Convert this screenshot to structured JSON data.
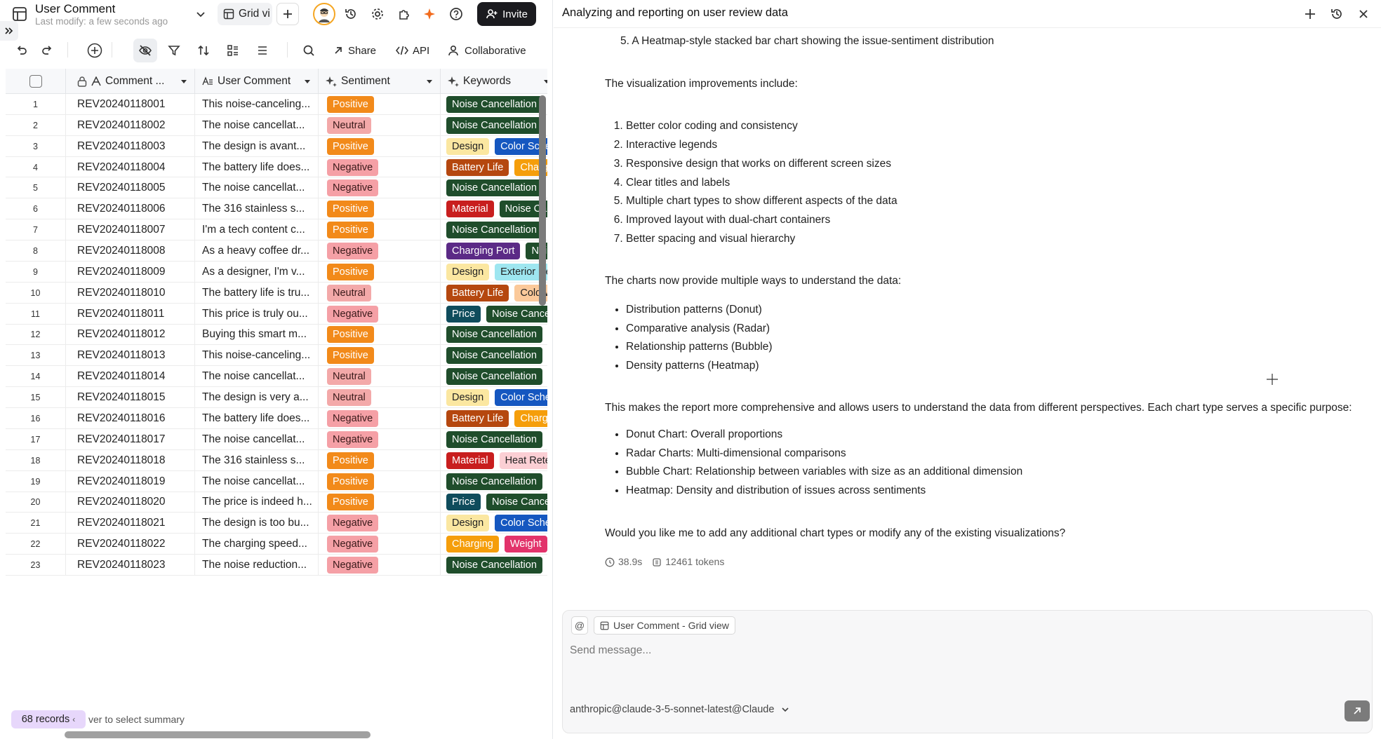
{
  "app": {
    "title": "User Comment",
    "subtitle": "Last modify: a few seconds ago",
    "view_tab": "Grid vi",
    "invite_label": "Invite"
  },
  "toolbar": {
    "share": "Share",
    "api": "API",
    "collaborative": "Collaborative"
  },
  "columns": [
    "Comment ...",
    "User Comment",
    "Sentiment",
    "Keywords"
  ],
  "rows": [
    {
      "no": "1",
      "id": "REV20240118001",
      "text": "This noise-canceling...",
      "sent": "Positive",
      "kw": [
        {
          "t": "Noise Cancellation",
          "c": "#1f4d2b"
        }
      ]
    },
    {
      "no": "2",
      "id": "REV20240118002",
      "text": "The noise cancellat...",
      "sent": "Neutral",
      "kw": [
        {
          "t": "Noise Cancellation",
          "c": "#1f4d2b"
        }
      ]
    },
    {
      "no": "3",
      "id": "REV20240118003",
      "text": "The design is avant...",
      "sent": "Positive",
      "kw": [
        {
          "t": "Design",
          "c": "#fbe7a1"
        },
        {
          "t": "Color Sche",
          "c": "#1557c0"
        }
      ]
    },
    {
      "no": "4",
      "id": "REV20240118004",
      "text": "The battery life does...",
      "sent": "Negative",
      "kw": [
        {
          "t": "Battery Life",
          "c": "#b5470f"
        },
        {
          "t": "Charg",
          "c": "#f59e0b"
        }
      ]
    },
    {
      "no": "5",
      "id": "REV20240118005",
      "text": "The noise cancellat...",
      "sent": "Negative",
      "kw": [
        {
          "t": "Noise Cancellation",
          "c": "#1f4d2b"
        }
      ]
    },
    {
      "no": "6",
      "id": "REV20240118006",
      "text": "The 316 stainless s...",
      "sent": "Positive",
      "kw": [
        {
          "t": "Material",
          "c": "#c81e1e"
        },
        {
          "t": "Noise Ca",
          "c": "#1f4d2b"
        }
      ]
    },
    {
      "no": "7",
      "id": "REV20240118007",
      "text": "I'm a tech content c...",
      "sent": "Positive",
      "kw": [
        {
          "t": "Noise Cancellation",
          "c": "#1f4d2b"
        }
      ]
    },
    {
      "no": "8",
      "id": "REV20240118008",
      "text": "As a heavy coffee dr...",
      "sent": "Negative",
      "kw": [
        {
          "t": "Charging Port",
          "c": "#5b2a86"
        },
        {
          "t": "Noi",
          "c": "#1f4d2b"
        }
      ]
    },
    {
      "no": "9",
      "id": "REV20240118009",
      "text": "As a designer, I'm v...",
      "sent": "Positive",
      "kw": [
        {
          "t": "Design",
          "c": "#fbe7a1"
        },
        {
          "t": "Exterior De",
          "c": "#9ee6f0"
        }
      ]
    },
    {
      "no": "10",
      "id": "REV20240118010",
      "text": "The battery life is tru...",
      "sent": "Neutral",
      "kw": [
        {
          "t": "Battery Life",
          "c": "#b5470f"
        },
        {
          "t": "Cold W",
          "c": "#fbc99a"
        }
      ]
    },
    {
      "no": "11",
      "id": "REV20240118011",
      "text": "This price is truly ou...",
      "sent": "Negative",
      "kw": [
        {
          "t": "Price",
          "c": "#0f4c5c"
        },
        {
          "t": "Noise Cance",
          "c": "#1f4d2b"
        }
      ]
    },
    {
      "no": "12",
      "id": "REV20240118012",
      "text": "Buying this smart m...",
      "sent": "Positive",
      "kw": [
        {
          "t": "Noise Cancellation",
          "c": "#1f4d2b"
        }
      ]
    },
    {
      "no": "13",
      "id": "REV20240118013",
      "text": "This noise-canceling...",
      "sent": "Positive",
      "kw": [
        {
          "t": "Noise Cancellation",
          "c": "#1f4d2b"
        }
      ]
    },
    {
      "no": "14",
      "id": "REV20240118014",
      "text": "The noise cancellat...",
      "sent": "Neutral",
      "kw": [
        {
          "t": "Noise Cancellation",
          "c": "#1f4d2b"
        }
      ]
    },
    {
      "no": "15",
      "id": "REV20240118015",
      "text": "The design is very a...",
      "sent": "Neutral",
      "kw": [
        {
          "t": "Design",
          "c": "#fbe7a1"
        },
        {
          "t": "Color Sche",
          "c": "#1557c0"
        }
      ]
    },
    {
      "no": "16",
      "id": "REV20240118016",
      "text": "The battery life does...",
      "sent": "Negative",
      "kw": [
        {
          "t": "Battery Life",
          "c": "#b5470f"
        },
        {
          "t": "Charg",
          "c": "#f59e0b"
        }
      ]
    },
    {
      "no": "17",
      "id": "REV20240118017",
      "text": "The noise cancellat...",
      "sent": "Negative",
      "kw": [
        {
          "t": "Noise Cancellation",
          "c": "#1f4d2b"
        }
      ]
    },
    {
      "no": "18",
      "id": "REV20240118018",
      "text": "The 316 stainless s...",
      "sent": "Positive",
      "kw": [
        {
          "t": "Material",
          "c": "#c81e1e"
        },
        {
          "t": "Heat Rete",
          "c": "#fbcfd4"
        }
      ]
    },
    {
      "no": "19",
      "id": "REV20240118019",
      "text": "The noise cancellat...",
      "sent": "Positive",
      "kw": [
        {
          "t": "Noise Cancellation",
          "c": "#1f4d2b"
        }
      ]
    },
    {
      "no": "20",
      "id": "REV20240118020",
      "text": "The price is indeed h...",
      "sent": "Positive",
      "kw": [
        {
          "t": "Price",
          "c": "#0f4c5c"
        },
        {
          "t": "Noise Cance",
          "c": "#1f4d2b"
        }
      ]
    },
    {
      "no": "21",
      "id": "REV20240118021",
      "text": "The design is too bu...",
      "sent": "Negative",
      "kw": [
        {
          "t": "Design",
          "c": "#fbe7a1"
        },
        {
          "t": "Color Sche",
          "c": "#1557c0"
        }
      ]
    },
    {
      "no": "22",
      "id": "REV20240118022",
      "text": "The charging speed...",
      "sent": "Negative",
      "kw": [
        {
          "t": "Charging",
          "c": "#f59e0b"
        },
        {
          "t": "Weight",
          "c": "#e2336b"
        }
      ]
    },
    {
      "no": "23",
      "id": "REV20240118023",
      "text": "The noise reduction...",
      "sent": "Negative",
      "kw": [
        {
          "t": "Noise Cancellation",
          "c": "#1f4d2b"
        }
      ]
    }
  ],
  "footer": {
    "records": "68 records",
    "hint": "ver to select summary"
  },
  "chat": {
    "title": "Analyzing and reporting on user review data",
    "top_item": "5. A Heatmap-style stacked bar chart showing the issue-sentiment distribution",
    "p1": "The visualization improvements include:",
    "improvements": [
      "Better color coding and consistency",
      "Interactive legends",
      "Responsive design that works on different screen sizes",
      "Clear titles and labels",
      "Multiple chart types to show different aspects of the data",
      "Improved layout with dual-chart containers",
      "Better spacing and visual hierarchy"
    ],
    "p2": "The charts now provide multiple ways to understand the data:",
    "ways": [
      "Distribution patterns (Donut)",
      "Comparative analysis (Radar)",
      "Relationship patterns (Bubble)",
      "Density patterns (Heatmap)"
    ],
    "p3": "This makes the report more comprehensive and allows users to understand the data from different perspectives. Each chart type serves a specific purpose:",
    "purposes": [
      "Donut Chart: Overall proportions",
      "Radar Charts: Multi-dimensional comparisons",
      "Bubble Chart: Relationship between variables with size as an additional dimension",
      "Heatmap: Density and distribution of issues across sentiments"
    ],
    "p4": "Would you like me to add any additional chart types or modify any of the existing visualizations?",
    "time": "38.9s",
    "tokens": "12461 tokens"
  },
  "composer": {
    "at": "@",
    "context_chip": "User Comment - Grid view",
    "placeholder": "Send message...",
    "model": "anthropic@claude-3-5-sonnet-latest@Claude"
  },
  "colors": {
    "positive": "#f28a1a",
    "neutral": "#f3a9a9",
    "negative": "#f5a0a6",
    "records_badge": "#e7d7fb",
    "invite_bg": "#1b1b1f"
  }
}
